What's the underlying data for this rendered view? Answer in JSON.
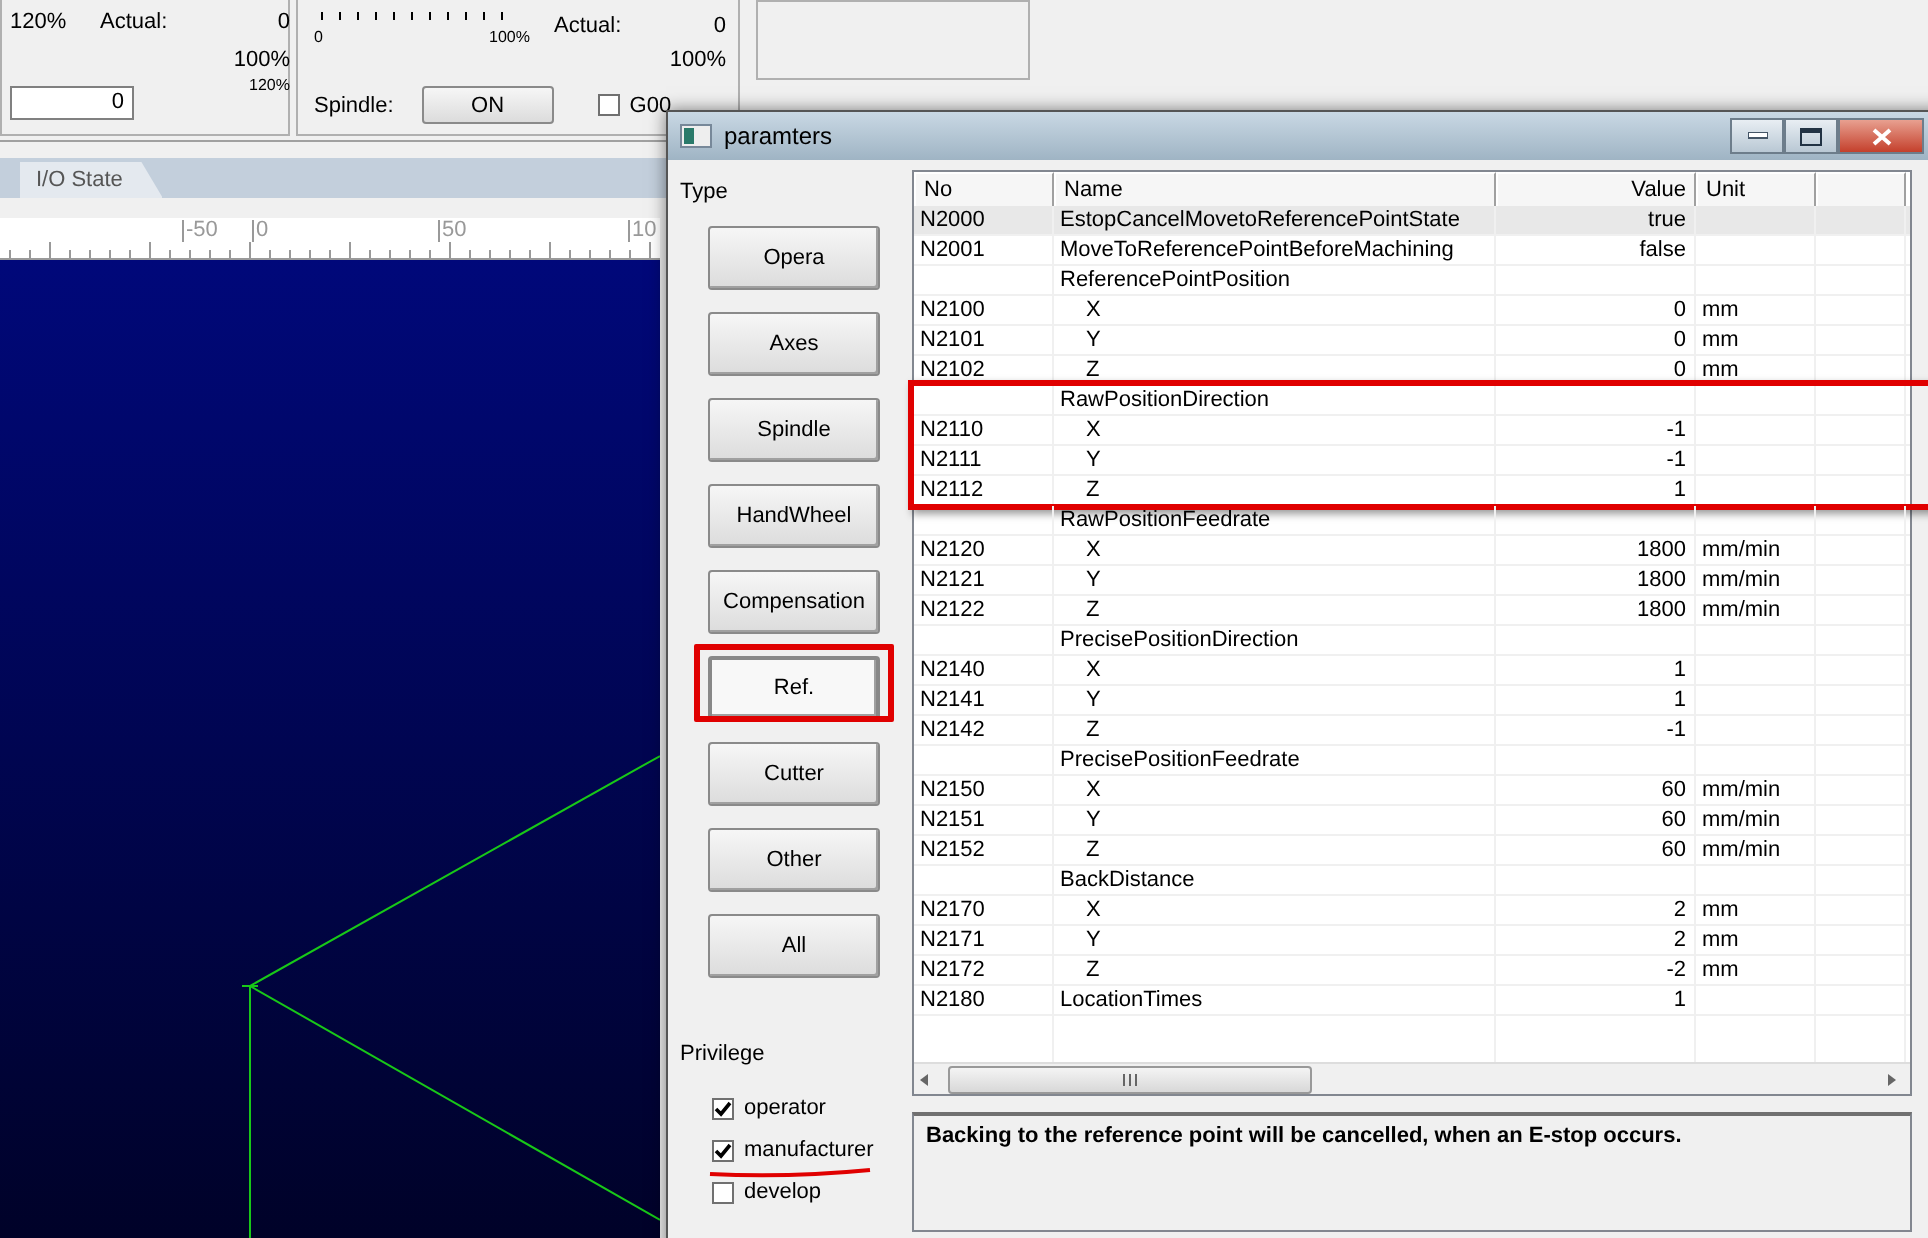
{
  "feed_panel": {
    "override": "120%",
    "actual_label": "Actual:",
    "actual": "0",
    "percent": "100%",
    "input_value": "0",
    "max": "120%"
  },
  "spindle_panel": {
    "scale_min": "0",
    "scale_max": "100%",
    "actual_label": "Actual:",
    "actual": "0",
    "percent": "100%",
    "spindle_label": "Spindle:",
    "spindle_button": "ON",
    "g00": {
      "label": "G00",
      "checked": false
    }
  },
  "tabs": [
    {
      "label": "I/O State",
      "selected": false
    }
  ],
  "ruler": {
    "labels": [
      "-50",
      "0",
      "50",
      "10"
    ]
  },
  "dialog": {
    "title": "paramters",
    "type_label": "Type",
    "types": [
      {
        "label": "Opera",
        "selected": false,
        "highlighted": false
      },
      {
        "label": "Axes",
        "selected": false,
        "highlighted": false
      },
      {
        "label": "Spindle",
        "selected": false,
        "highlighted": false
      },
      {
        "label": "HandWheel",
        "selected": false,
        "highlighted": false
      },
      {
        "label": "Compensation",
        "selected": false,
        "highlighted": false
      },
      {
        "label": "Ref.",
        "selected": true,
        "highlighted": true
      },
      {
        "label": "Cutter",
        "selected": false,
        "highlighted": false
      },
      {
        "label": "Other",
        "selected": false,
        "highlighted": false
      },
      {
        "label": "All",
        "selected": false,
        "highlighted": false
      }
    ],
    "privilege_label": "Privilege",
    "privileges": [
      {
        "label": "operator",
        "checked": true,
        "underlined": false
      },
      {
        "label": "manufacturer",
        "checked": true,
        "underlined": true
      },
      {
        "label": "develop",
        "checked": false,
        "underlined": false
      }
    ],
    "table": {
      "columns": [
        "No",
        "Name",
        "Value",
        "Unit"
      ],
      "rows": [
        {
          "no": "N2000",
          "name": "EstopCancelMovetoReferencePointState",
          "value": "true",
          "selected": true
        },
        {
          "no": "N2001",
          "name": "MoveToReferencePointBeforeMachining",
          "value": "false",
          "selected": false
        },
        {
          "name": "ReferencePointPosition",
          "selected": false,
          "highlighted": false,
          "children": [
            {
              "no": "N2100",
              "name": "X",
              "value": "0",
              "unit": "mm",
              "selected": false
            },
            {
              "no": "N2101",
              "name": "Y",
              "value": "0",
              "unit": "mm",
              "selected": false
            },
            {
              "no": "N2102",
              "name": "Z",
              "value": "0",
              "unit": "mm",
              "selected": false
            }
          ]
        },
        {
          "name": "RawPositionDirection",
          "selected": false,
          "highlighted": true,
          "children": [
            {
              "no": "N2110",
              "name": "X",
              "value": "-1",
              "selected": false
            },
            {
              "no": "N2111",
              "name": "Y",
              "value": "-1",
              "selected": false
            },
            {
              "no": "N2112",
              "name": "Z",
              "value": "1",
              "selected": false
            }
          ]
        },
        {
          "name": "RawPositionFeedrate",
          "selected": false,
          "highlighted": false,
          "children": [
            {
              "no": "N2120",
              "name": "X",
              "value": "1800",
              "unit": "mm/min",
              "selected": false
            },
            {
              "no": "N2121",
              "name": "Y",
              "value": "1800",
              "unit": "mm/min",
              "selected": false
            },
            {
              "no": "N2122",
              "name": "Z",
              "value": "1800",
              "unit": "mm/min",
              "selected": false
            }
          ]
        },
        {
          "name": "PrecisePositionDirection",
          "selected": false,
          "highlighted": false,
          "children": [
            {
              "no": "N2140",
              "name": "X",
              "value": "1",
              "selected": false
            },
            {
              "no": "N2141",
              "name": "Y",
              "value": "1",
              "selected": false
            },
            {
              "no": "N2142",
              "name": "Z",
              "value": "-1",
              "selected": false
            }
          ]
        },
        {
          "name": "PrecisePositionFeedrate",
          "selected": false,
          "highlighted": false,
          "children": [
            {
              "no": "N2150",
              "name": "X",
              "value": "60",
              "unit": "mm/min",
              "selected": false
            },
            {
              "no": "N2151",
              "name": "Y",
              "value": "60",
              "unit": "mm/min",
              "selected": false
            },
            {
              "no": "N2152",
              "name": "Z",
              "value": "60",
              "unit": "mm/min",
              "selected": false
            }
          ]
        },
        {
          "name": "BackDistance",
          "selected": false,
          "highlighted": false,
          "children": [
            {
              "no": "N2170",
              "name": "X",
              "value": "2",
              "unit": "mm",
              "selected": false
            },
            {
              "no": "N2171",
              "name": "Y",
              "value": "2",
              "unit": "mm",
              "selected": false
            },
            {
              "no": "N2172",
              "name": "Z",
              "value": "-2",
              "unit": "mm",
              "selected": false
            }
          ]
        },
        {
          "no": "N2180",
          "name": "LocationTimes",
          "value": "1",
          "selected": false
        }
      ]
    },
    "description": "Backing to the reference point will be cancelled, when an E-stop occurs."
  }
}
